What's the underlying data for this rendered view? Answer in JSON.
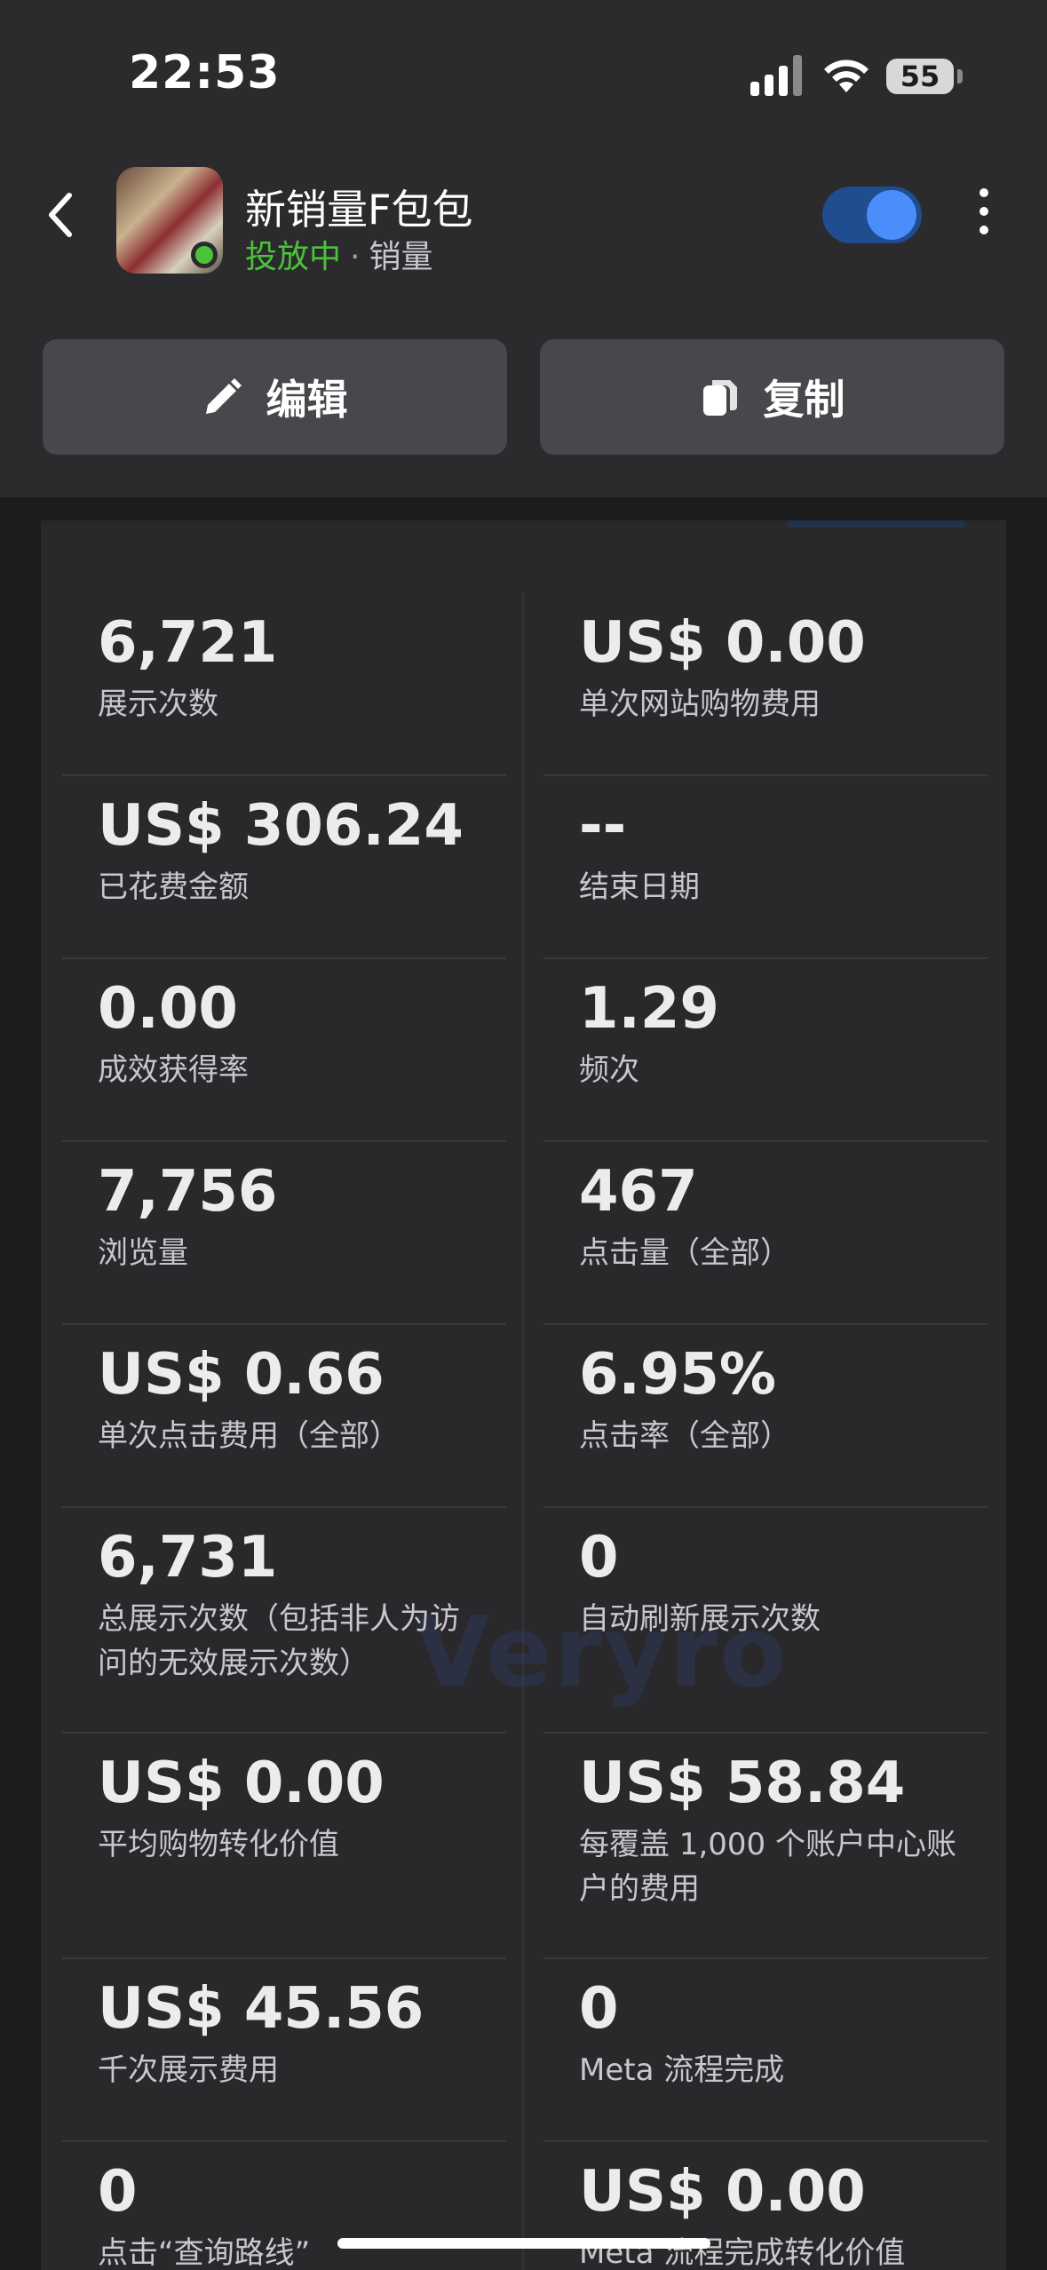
{
  "status_bar": {
    "time": "22:53",
    "battery": "55"
  },
  "header": {
    "title": "新销量F包包",
    "status": "投放中",
    "separator": "·",
    "objective": "销量",
    "toggle_on": true
  },
  "actions": {
    "edit_label": "编辑",
    "copy_label": "复制"
  },
  "watermark": "Veryro",
  "metrics": {
    "left": [
      {
        "value": "6,721",
        "label": "展示次数"
      },
      {
        "value": "US$ 306.24",
        "label": "已花费金额"
      },
      {
        "value": "0.00",
        "label": "成效获得率"
      },
      {
        "value": "7,756",
        "label": "浏览量"
      },
      {
        "value": "US$ 0.66",
        "label": "单次点击费用（全部）"
      },
      {
        "value": "6,731",
        "label": "总展示次数（包括非人为访问的无效展示次数）"
      },
      {
        "value": "US$ 0.00",
        "label": "平均购物转化价值"
      },
      {
        "value": "US$ 45.56",
        "label": "千次展示费用"
      },
      {
        "value": "0",
        "label": "点击“查询路线”"
      }
    ],
    "right": [
      {
        "value": "US$ 0.00",
        "label": "单次网站购物费用"
      },
      {
        "value": "--",
        "label": "结束日期"
      },
      {
        "value": "1.29",
        "label": "频次"
      },
      {
        "value": "467",
        "label": "点击量（全部）"
      },
      {
        "value": "6.95%",
        "label": "点击率（全部）"
      },
      {
        "value": "0",
        "label": "自动刷新展示次数"
      },
      {
        "value": "US$ 58.84",
        "label": "每覆盖 1,000 个账户中心账户的费用"
      },
      {
        "value": "0",
        "label": "Meta 流程完成"
      },
      {
        "value": "US$ 0.00",
        "label": "Meta 流程完成转化价值"
      }
    ]
  },
  "colors": {
    "background": "#1c1c1e",
    "header": "#2b2b2e",
    "card": "#29292b",
    "status_green": "#4cc23a",
    "toggle_blue": "#4b8dfa"
  }
}
